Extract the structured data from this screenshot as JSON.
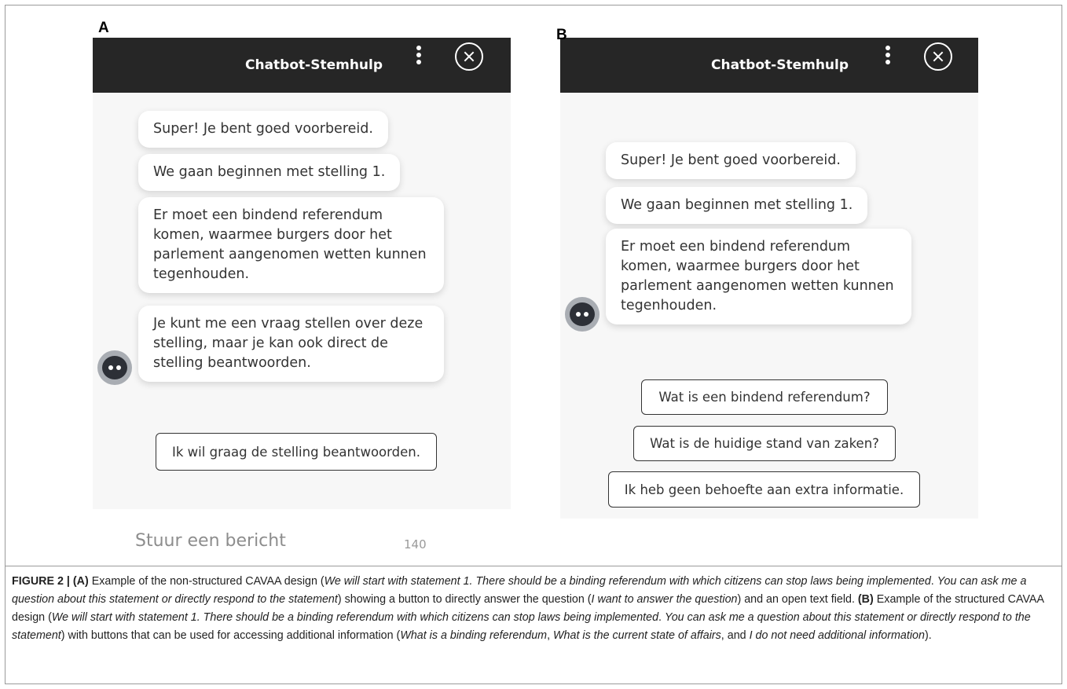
{
  "panels": {
    "a": {
      "letter": "A",
      "title": "Chatbot-Stemhulp",
      "messages": [
        "Super! Je bent goed voorbereid.",
        "We gaan beginnen met stelling 1.",
        "Er moet een bindend referendum komen, waarmee burgers door het parlement aangenomen wetten kunnen tegenhouden.",
        "Je kunt me een vraag stellen over deze stelling, maar je kan ook direct de stelling beantwoorden."
      ],
      "buttons": [
        "Ik wil graag de stelling beantwoorden."
      ],
      "input_placeholder": "Stuur een bericht",
      "char_counter": "140"
    },
    "b": {
      "letter": "B",
      "title": "Chatbot-Stemhulp",
      "messages": [
        "Super! Je bent goed voorbereid.",
        "We gaan beginnen met stelling 1.",
        "Er moet een bindend referendum komen, waarmee burgers door het parlement aangenomen wetten kunnen tegenhouden."
      ],
      "buttons": [
        "Wat is een bindend referendum?",
        "Wat is de huidige stand van zaken?",
        "Ik heb geen behoefte aan extra informatie."
      ]
    }
  },
  "icons": {
    "menu": "kebab-menu-icon",
    "close": "close-circle-icon",
    "bot": "bot-avatar-icon"
  },
  "caption": {
    "figure_label": "FIGURE 2 |",
    "a_marker": "(A)",
    "a_intro": "Example of the non-structured CAVAA design (",
    "a_quote1": "We will start with statement 1. There should be a binding referendum with which citizens can stop laws being implemented",
    "a_sep1": ". ",
    "a_quote2": "You can ask me a question about this statement or directly respond to the statement",
    "a_mid": ") showing a button to directly answer the question (",
    "a_quote3": "I want to answer the question",
    "a_end": ") and an open text field.",
    "b_marker": "(B)",
    "b_intro": "Example of the structured CAVAA design (",
    "b_quote1": "We will start with statement 1. There should be a binding referendum with which citizens can stop laws being implemented",
    "b_sep1": ". ",
    "b_quote2": "You can ask me a question about this statement or directly respond to the statement",
    "b_mid": ") with buttons that can be used for accessing additional information (",
    "b_quote3": "What is a binding referendum",
    "b_sep2": ", ",
    "b_quote4": "What is the current state of affairs",
    "b_sep3": ", and ",
    "b_quote5": "I do not need additional information",
    "b_end": ")."
  },
  "colors": {
    "header_bg": "#262626",
    "panel_bg": "#f7f7f7",
    "bubble_bg": "#ffffff",
    "text": "#333333",
    "placeholder": "#8d8d8d"
  }
}
